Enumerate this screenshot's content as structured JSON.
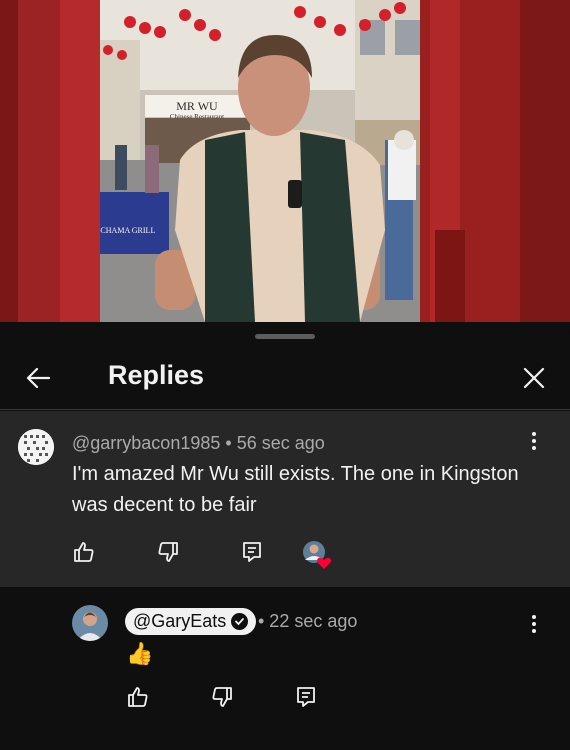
{
  "video": {
    "shop_sign": "MR WU",
    "shop_sign_sub": "Chinese Restaurant",
    "banner_text": "OCHAMA GRILL"
  },
  "sheet": {
    "title": "Replies",
    "icons": {
      "back": "back-arrow-icon",
      "close": "close-icon"
    }
  },
  "parent_comment": {
    "author": "@garrybacon1985",
    "separator": "•",
    "time": "56 sec ago",
    "text": "I'm amazed Mr Wu still exists. The one in Kingston was decent to be fair",
    "actions": [
      "like-icon",
      "dislike-icon",
      "reply-icon"
    ],
    "hearted_by_creator": true,
    "heart_color": "#ff0033"
  },
  "reply": {
    "author": "@GaryEats",
    "verified": true,
    "time": "• 22 sec ago",
    "text": "👍",
    "actions": [
      "like-icon",
      "dislike-icon",
      "reply-icon"
    ]
  },
  "colors": {
    "background": "#0f0f0f",
    "parent_background": "#272727",
    "secondary_text": "#aaaaaa",
    "primary_text": "#f1f1f1"
  }
}
